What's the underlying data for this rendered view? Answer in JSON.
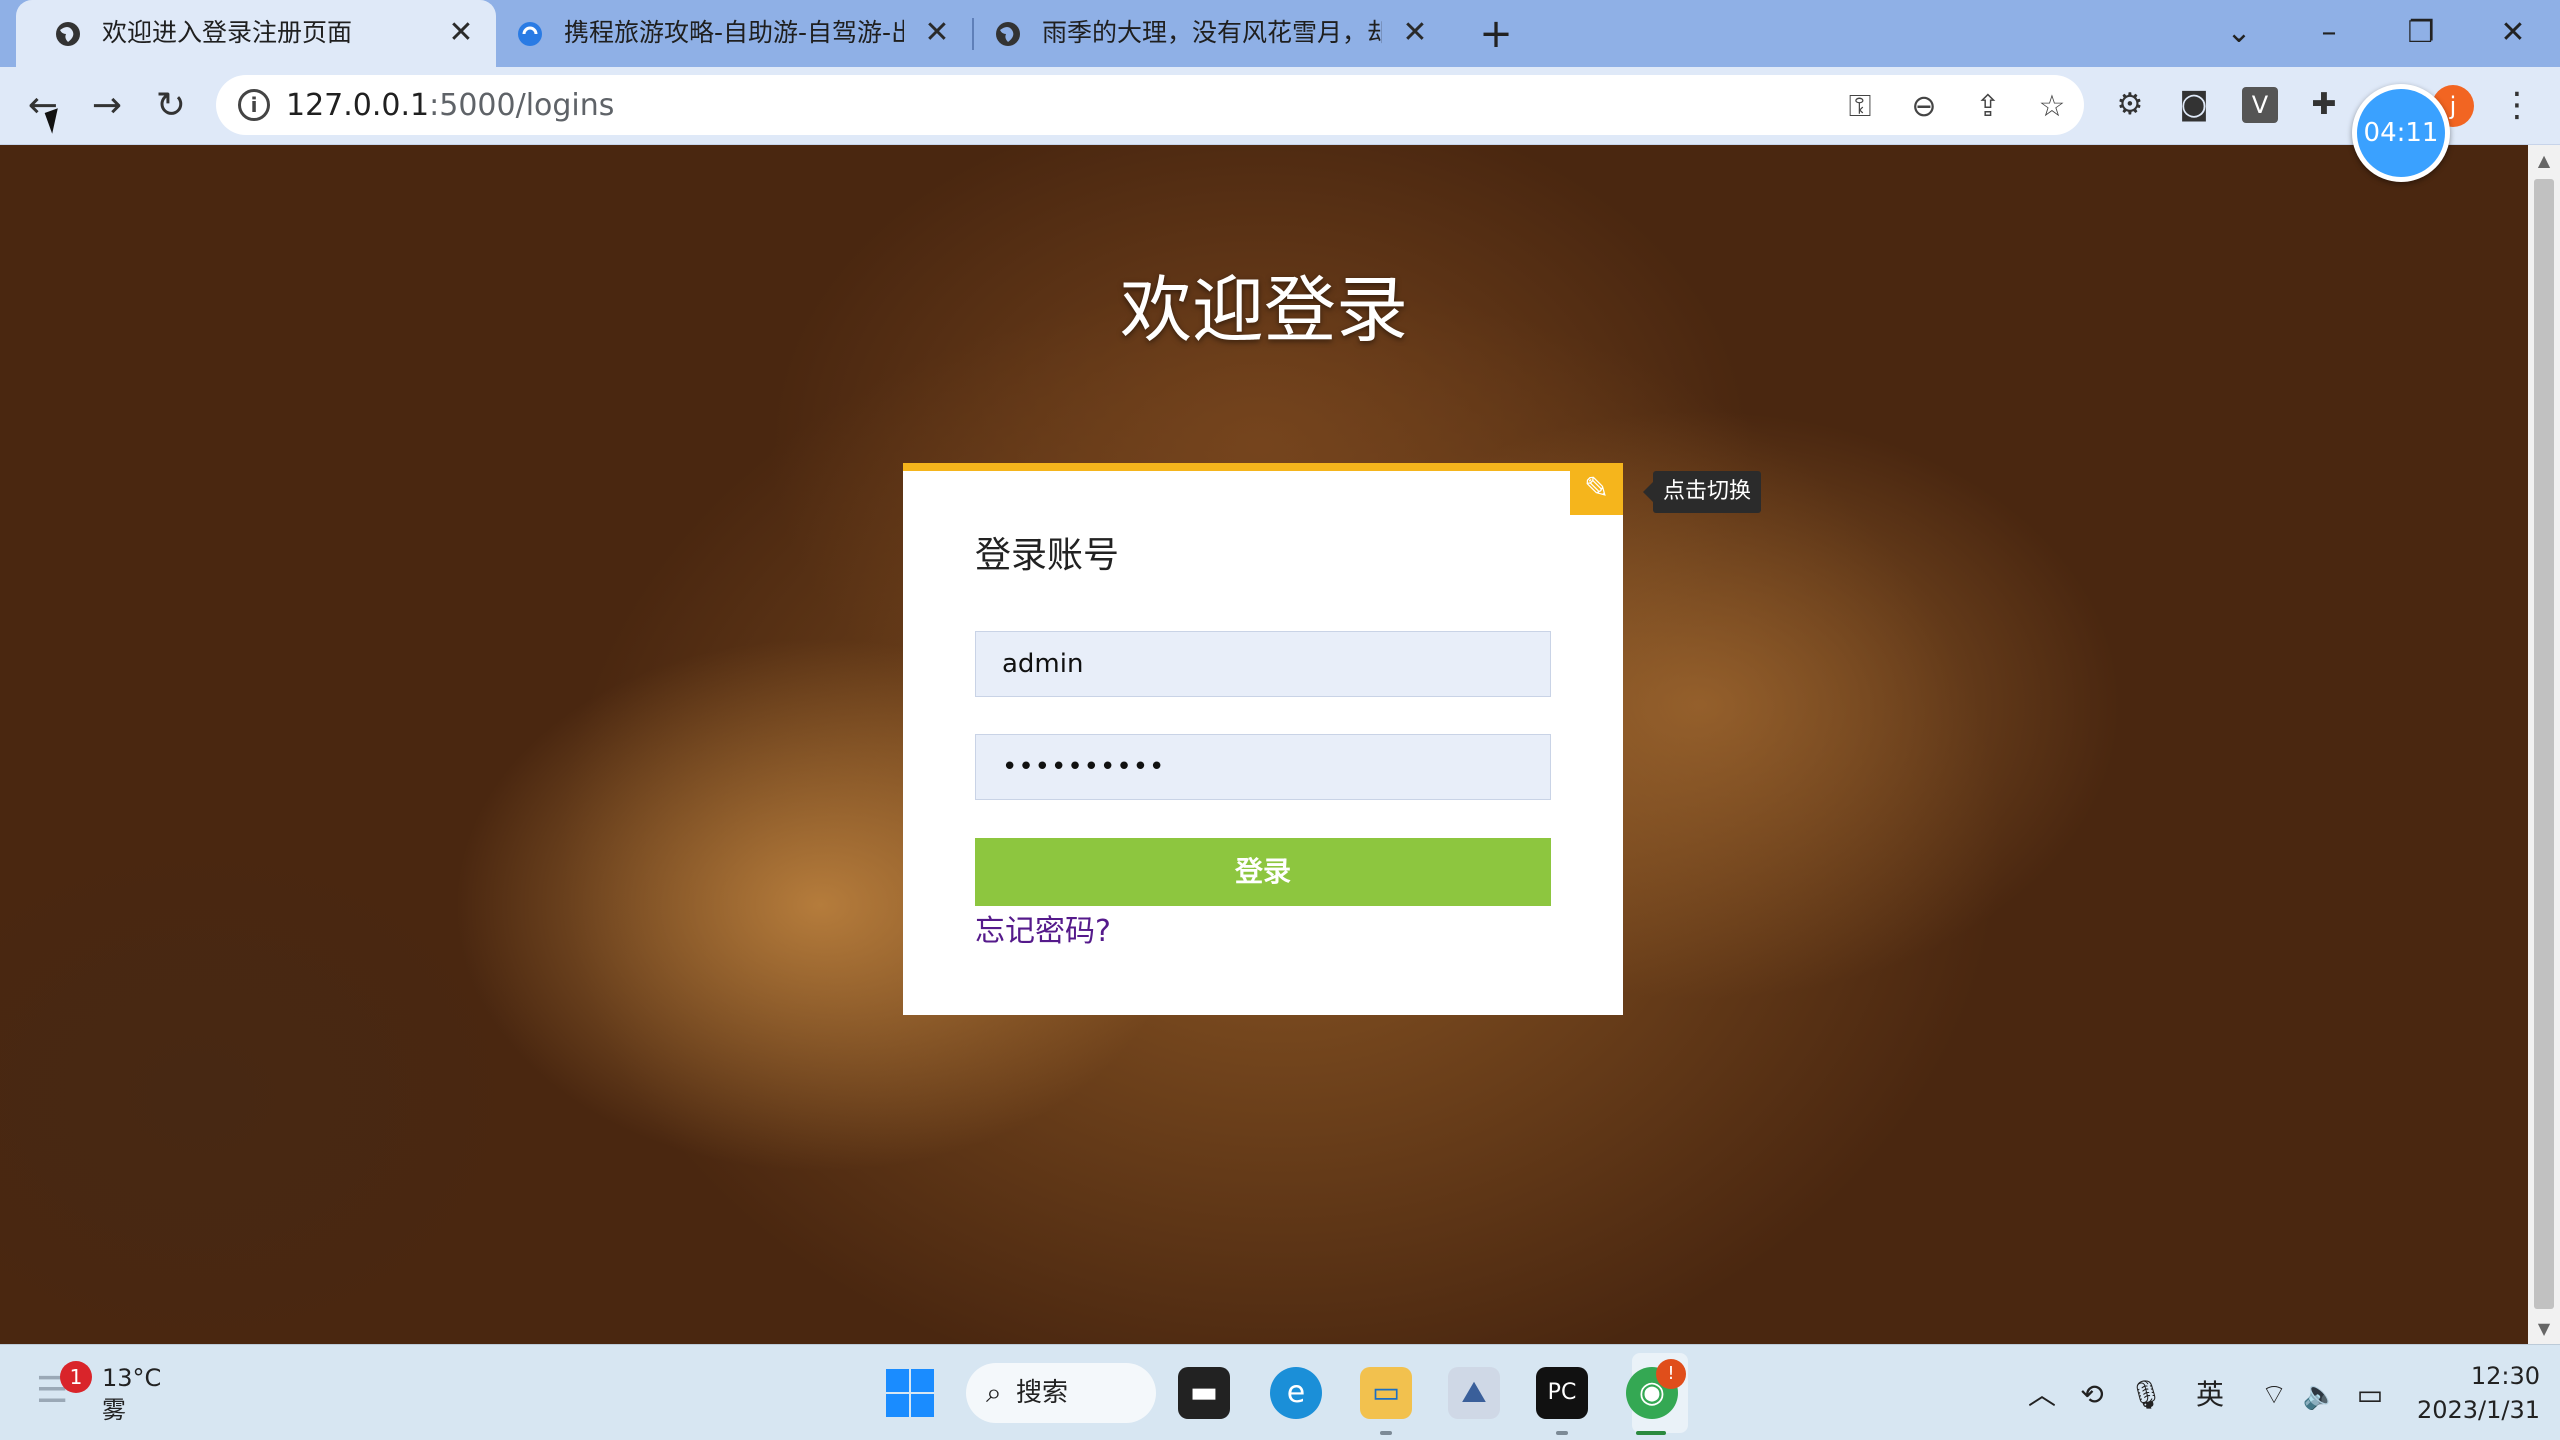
{
  "browser": {
    "tabs": [
      {
        "title": "欢迎进入登录注册页面",
        "active": true,
        "icon": "globe-icon"
      },
      {
        "title": "携程旅游攻略-自助游-自驾游-出",
        "active": false,
        "icon": "ctrip-icon"
      },
      {
        "title": "雨季的大理，没有风花雪月，却",
        "active": false,
        "icon": "globe-icon"
      }
    ],
    "close_glyph": "✕",
    "new_tab_glyph": "+",
    "url_host": "127.0.0.1",
    "url_path": ":5000/logins",
    "profile_initial": "j",
    "timer": "04:11",
    "ext_v": "V"
  },
  "page": {
    "heading": "欢迎登录",
    "tooltip": "点击切换",
    "card_title": "登录账号",
    "username_value": "admin",
    "password_value": "••••••••••",
    "login_button": "登录",
    "forgot_link": "忘记密码?"
  },
  "taskbar": {
    "weather_badge": "1",
    "temperature": "13°C",
    "weather": "雾",
    "search_label": "搜索",
    "ime": "英",
    "time": "12:30",
    "date": "2023/1/31",
    "chrome_badge": "!"
  },
  "colors": {
    "accent_yellow": "#f5b51c",
    "login_green": "#8dc63f",
    "tab_bar": "#8fb0e6",
    "forgot_link": "#551a8b"
  }
}
